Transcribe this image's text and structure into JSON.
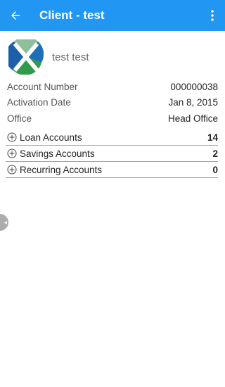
{
  "appbar": {
    "title": "Client - test",
    "back_icon": "arrow-left-icon",
    "menu_icon": "more-vert-icon",
    "color": "#2196F3"
  },
  "profile": {
    "name": "test test",
    "logo_icon": "client-logo"
  },
  "details": [
    {
      "label": "Account Number",
      "value": "000000038"
    },
    {
      "label": "Activation Date",
      "value": "Jan 8, 2015"
    },
    {
      "label": "Office",
      "value": "Head Office"
    }
  ],
  "accounts": [
    {
      "label": "Loan Accounts",
      "count": "14"
    },
    {
      "label": "Savings Accounts",
      "count": "2"
    },
    {
      "label": "Recurring Accounts",
      "count": "0"
    }
  ]
}
